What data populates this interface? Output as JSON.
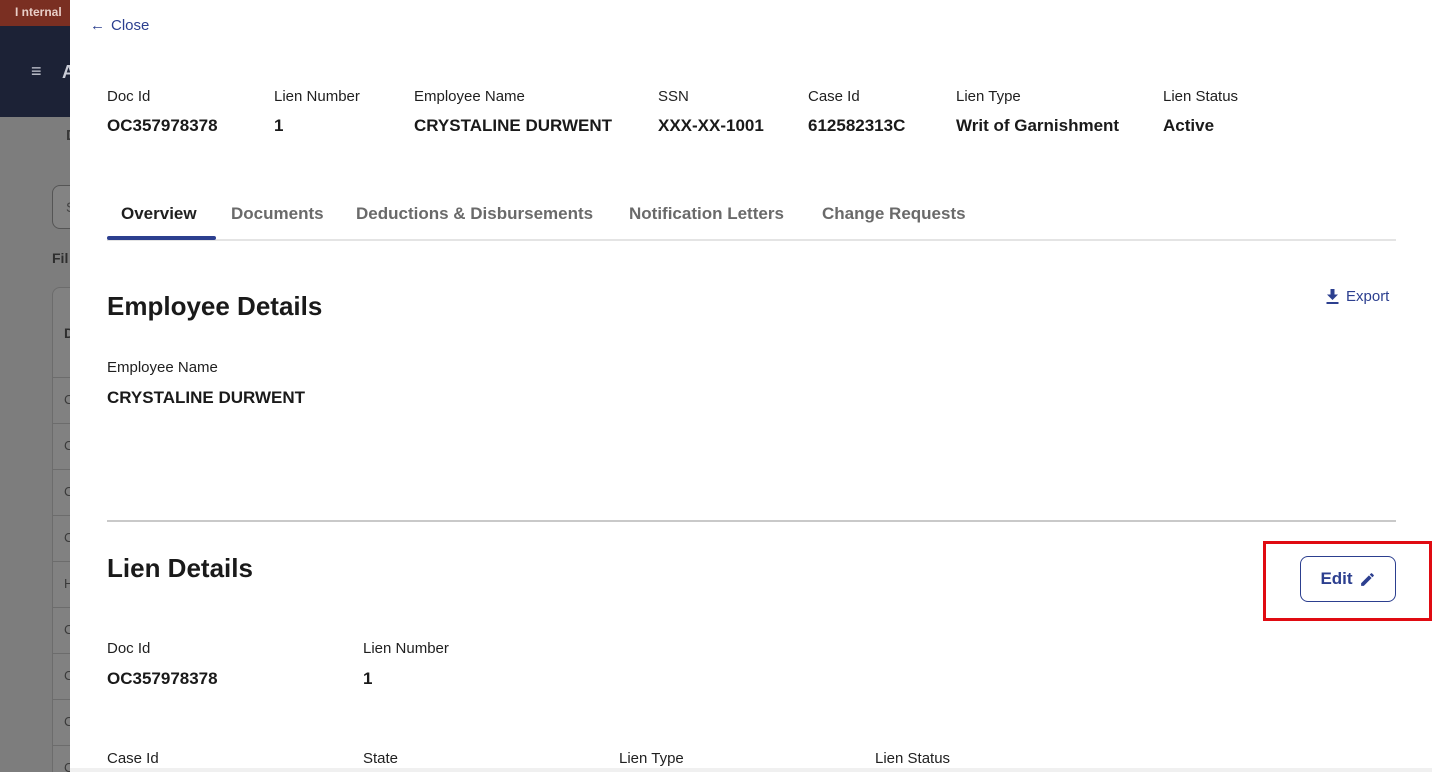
{
  "background": {
    "banner_text": "I nternal",
    "header_text": "A",
    "tab_letter": "D",
    "search_letter": "S",
    "filter_text": "Fil",
    "table_header": "D",
    "rows": [
      "C",
      "C",
      "C",
      "C",
      "H",
      "C",
      "C",
      "C",
      "C"
    ]
  },
  "panel": {
    "close_label": "Close",
    "summary": [
      {
        "label": "Doc Id",
        "value": "OC357978378"
      },
      {
        "label": "Lien Number",
        "value": "1"
      },
      {
        "label": "Employee Name",
        "value": "CRYSTALINE DURWENT"
      },
      {
        "label": "SSN",
        "value": "XXX-XX-1001"
      },
      {
        "label": "Case Id",
        "value": "612582313C"
      },
      {
        "label": "Lien Type",
        "value": "Writ of Garnishment"
      },
      {
        "label": "Lien Status",
        "value": "Active"
      }
    ],
    "tabs": [
      {
        "label": "Overview",
        "active": true
      },
      {
        "label": "Documents",
        "active": false
      },
      {
        "label": "Deductions & Disbursements",
        "active": false
      },
      {
        "label": "Notification Letters",
        "active": false
      },
      {
        "label": "Change Requests",
        "active": false
      }
    ],
    "export_label": "Export",
    "employee_details": {
      "title": "Employee Details",
      "fields": [
        {
          "label": "Employee Name",
          "value": "CRYSTALINE DURWENT"
        }
      ]
    },
    "lien_details": {
      "title": "Lien Details",
      "edit_label": "Edit",
      "fields": [
        {
          "label": "Doc Id",
          "value": "OC357978378"
        },
        {
          "label": "Lien Number",
          "value": "1"
        }
      ],
      "next_row_labels": [
        "Case Id",
        "State",
        "Lien Type",
        "Lien Status"
      ]
    }
  },
  "colors": {
    "accent": "#2c3f8f",
    "highlight": "#e00b12",
    "banner": "#7a2f22",
    "header": "#1c2236"
  }
}
